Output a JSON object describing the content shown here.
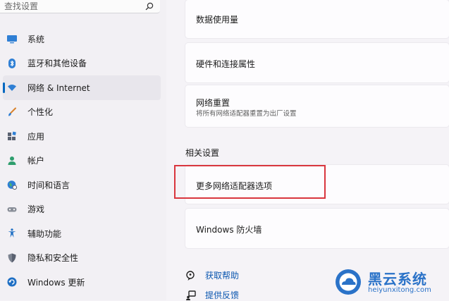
{
  "search": {
    "placeholder": "查找设置"
  },
  "sidebar": {
    "items": [
      {
        "label": "系统",
        "icon": "monitor-icon"
      },
      {
        "label": "蓝牙和其他设备",
        "icon": "bluetooth-icon"
      },
      {
        "label": "网络 & Internet",
        "icon": "wifi-icon",
        "active": true
      },
      {
        "label": "个性化",
        "icon": "brush-icon"
      },
      {
        "label": "应用",
        "icon": "apps-icon"
      },
      {
        "label": "帐户",
        "icon": "person-icon"
      },
      {
        "label": "时间和语言",
        "icon": "globe-clock-icon"
      },
      {
        "label": "游戏",
        "icon": "gamepad-icon"
      },
      {
        "label": "辅助功能",
        "icon": "accessibility-icon"
      },
      {
        "label": "隐私和安全性",
        "icon": "shield-icon"
      },
      {
        "label": "Windows 更新",
        "icon": "update-icon"
      }
    ]
  },
  "main": {
    "cards": {
      "data_usage": {
        "title": "数据使用量"
      },
      "hardware": {
        "title": "硬件和连接属性"
      },
      "network_reset": {
        "title": "网络重置",
        "description": "将所有网络适配器重置为出厂设置"
      }
    },
    "related_settings": {
      "title": "相关设置",
      "more_adapter_options": "更多网络适配器选项",
      "windows_firewall": "Windows 防火墙"
    },
    "help": {
      "get_help": "获取帮助",
      "give_feedback": "提供反馈"
    }
  },
  "watermark": {
    "title": "黑云系统",
    "url": "heiyunxitong.com"
  },
  "colors": {
    "accent": "#0067c0",
    "highlight": "#d9363e",
    "link": "#0b57b0",
    "watermark": "#2a72c8"
  }
}
